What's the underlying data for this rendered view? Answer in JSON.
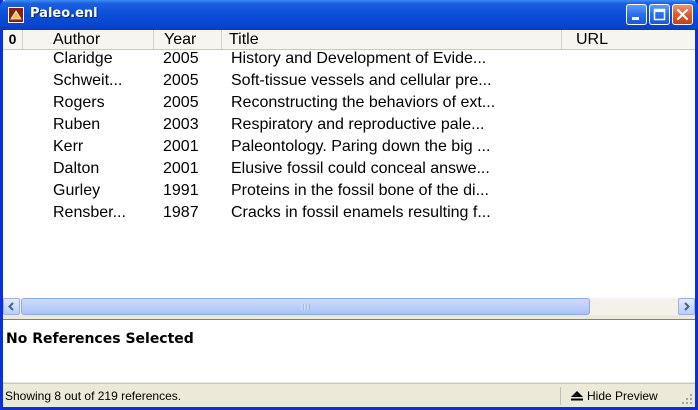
{
  "window": {
    "title": "Paleo.enl"
  },
  "columns": {
    "attachment": "0",
    "author": "Author",
    "year": "Year",
    "title": "Title",
    "url": "URL"
  },
  "references": [
    {
      "author": "Claridge",
      "year": "2005",
      "title": "History and Development of Evide..."
    },
    {
      "author": "Schweit...",
      "year": "2005",
      "title": "Soft-tissue vessels and cellular pre..."
    },
    {
      "author": "Rogers",
      "year": "2005",
      "title": "Reconstructing the behaviors of ext..."
    },
    {
      "author": "Ruben",
      "year": "2003",
      "title": "Respiratory and reproductive pale..."
    },
    {
      "author": "Kerr",
      "year": "2001",
      "title": "Paleontology. Paring down the big ..."
    },
    {
      "author": "Dalton",
      "year": "2001",
      "title": "Elusive fossil could conceal answe..."
    },
    {
      "author": "Gurley",
      "year": "1991",
      "title": "Proteins in the fossil bone of the di..."
    },
    {
      "author": "Rensber...",
      "year": "1987",
      "title": "Cracks in fossil enamels resulting f..."
    }
  ],
  "preview": {
    "text": "No References Selected"
  },
  "status": {
    "text": "Showing 8 out of 219 references.",
    "hide_preview_label": "Hide Preview"
  },
  "icons": {
    "app": "endnote-library-icon",
    "minimize": "minimize-icon",
    "maximize": "maximize-icon",
    "close": "close-icon",
    "hide_preview": "up-arrow-icon"
  },
  "colors": {
    "titlebar": "#0a4ed8",
    "window_border": "#0831d9",
    "chrome": "#ece9d8",
    "close_button": "#e05a2e"
  }
}
